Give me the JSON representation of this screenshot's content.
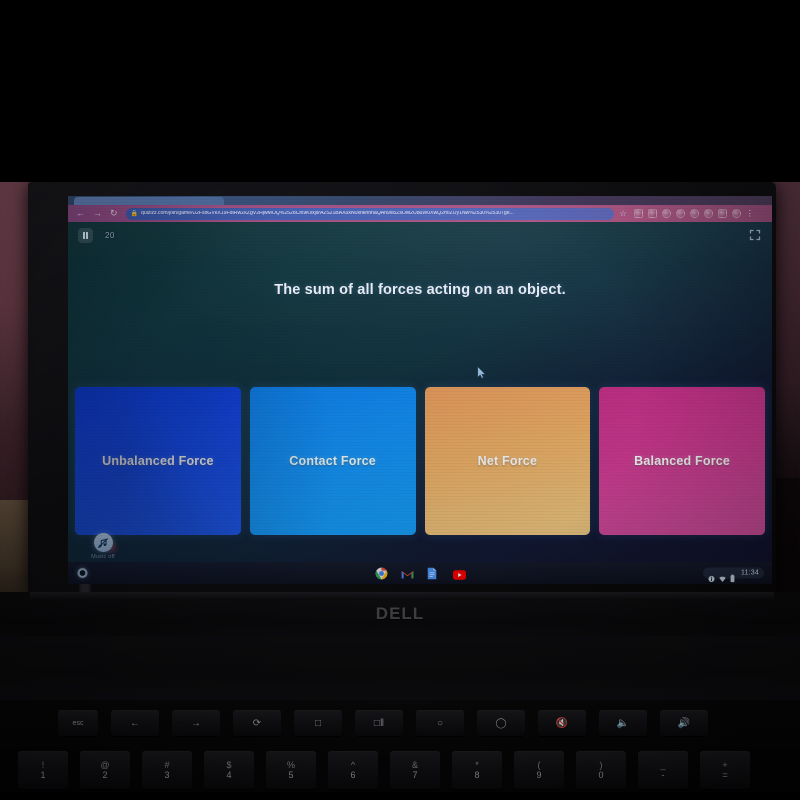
{
  "device": {
    "brand_logo": "DELL",
    "type": "chromebook-laptop"
  },
  "browser": {
    "nav": {
      "back_icon": "←",
      "forward_icon": "→",
      "reload_icon": "↻"
    },
    "omnibox": {
      "lock_icon": "🔒",
      "url": "quizizz.com/join/game/U2FsdGVkX19FdIRwZkZgV2HjwMOQ%2528Cfx9KxxjsrA2S21BAXuxN0xhkhnnaQAh9xi5ZsOM2U8uW0XwQ2mIZUy1Nw%2530%25307ge...",
      "bookmark_star_icon": "☆"
    },
    "menu_icon": "⋮",
    "extension_count": 8
  },
  "quiz": {
    "pause_label": "pause",
    "timer": "20",
    "fullscreen_icon": "fullscreen",
    "question": "The sum of all forces acting on an object.",
    "answers": [
      {
        "label": "Unbalanced Force",
        "color": "#1449e8"
      },
      {
        "label": "Contact Force",
        "color": "#1490f4"
      },
      {
        "label": "Net Force",
        "color": "#edb168"
      },
      {
        "label": "Balanced Force",
        "color": "#cf3a92"
      }
    ],
    "music": {
      "label": "Music off",
      "icon": "music-muted-icon"
    }
  },
  "shelf": {
    "launcher_label": "Launcher",
    "apps": [
      {
        "name": "chrome"
      },
      {
        "name": "gmail"
      },
      {
        "name": "google-docs"
      },
      {
        "name": "youtube"
      }
    ],
    "tray": {
      "info_icon": "i",
      "wifi_icon": "wifi",
      "battery_icon": "battery",
      "clock": "11:34"
    }
  },
  "keyboard": {
    "function_row": [
      {
        "label": "esc",
        "name": "escape"
      },
      {
        "label": "←",
        "name": "back"
      },
      {
        "label": "→",
        "name": "forward"
      },
      {
        "label": "⟳",
        "name": "reload"
      },
      {
        "label": "□",
        "name": "fullscreen"
      },
      {
        "label": "□‖",
        "name": "overview"
      },
      {
        "label": "○",
        "name": "brightness-down"
      },
      {
        "label": "◯",
        "name": "brightness-up"
      },
      {
        "label": "🔇",
        "name": "mute"
      },
      {
        "label": "🔈",
        "name": "volume-down"
      },
      {
        "label": "🔊",
        "name": "volume-up"
      }
    ],
    "number_row": [
      {
        "sym": "!",
        "dig": "1"
      },
      {
        "sym": "@",
        "dig": "2"
      },
      {
        "sym": "#",
        "dig": "3"
      },
      {
        "sym": "$",
        "dig": "4"
      },
      {
        "sym": "%",
        "dig": "5"
      },
      {
        "sym": "^",
        "dig": "6"
      },
      {
        "sym": "&",
        "dig": "7"
      },
      {
        "sym": "*",
        "dig": "8"
      },
      {
        "sym": "(",
        "dig": "9"
      },
      {
        "sym": ")",
        "dig": "0"
      },
      {
        "sym": "_",
        "dig": "-"
      },
      {
        "sym": "+",
        "dig": "="
      }
    ]
  }
}
